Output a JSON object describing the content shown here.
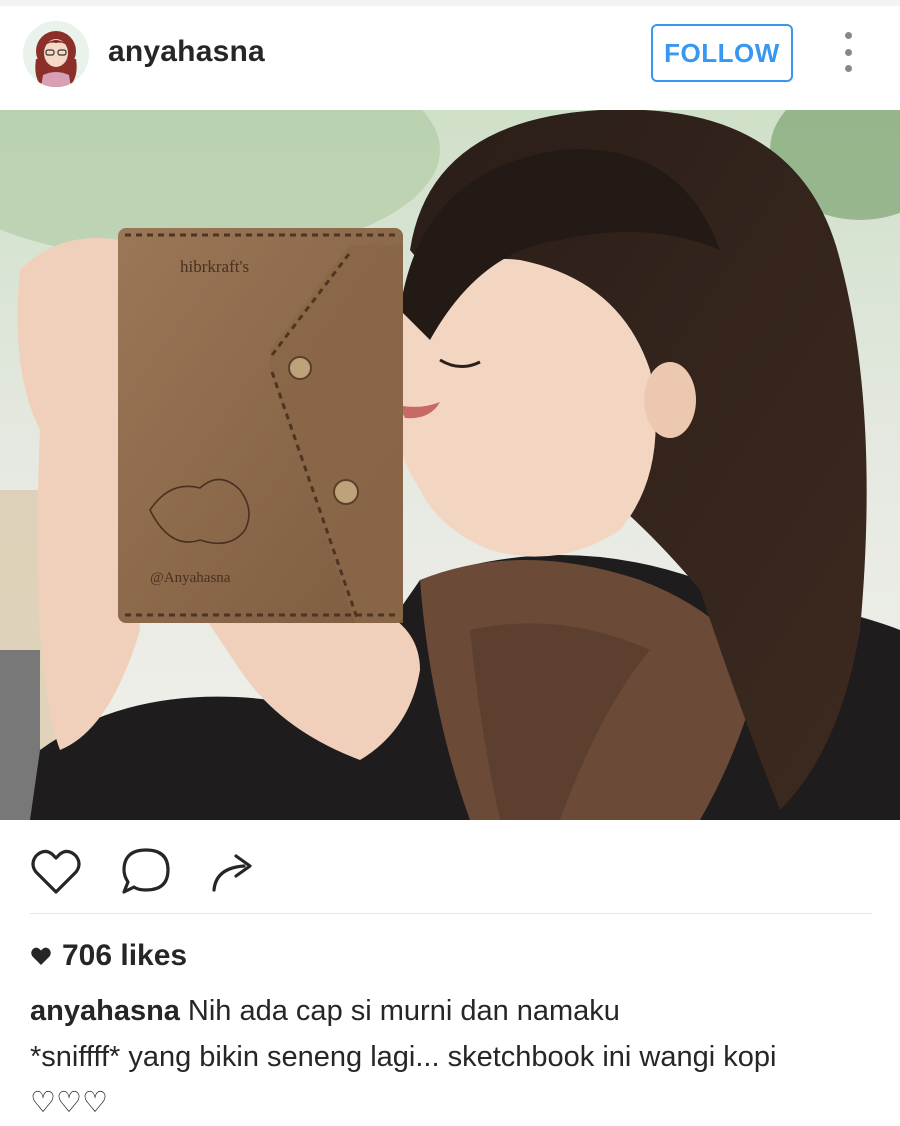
{
  "header": {
    "username": "anyahasna",
    "follow_label": "FOLLOW"
  },
  "post": {
    "notebook_brand": "hibrkraft's",
    "notebook_tag": "@Anyahasna"
  },
  "likes": {
    "text": "706 likes"
  },
  "caption": {
    "username": "anyahasna",
    "text": "Nih ada cap si murni dan namaku\n*sniffff* yang bikin seneng lagi... sketchbook ini wangi kopi\n♡♡♡"
  },
  "colors": {
    "accent": "#3897f0",
    "text": "#262626",
    "divider": "#e6e6e6"
  },
  "icons": [
    "like-icon",
    "comment-icon",
    "share-icon",
    "more-icon",
    "heart-filled-icon"
  ]
}
